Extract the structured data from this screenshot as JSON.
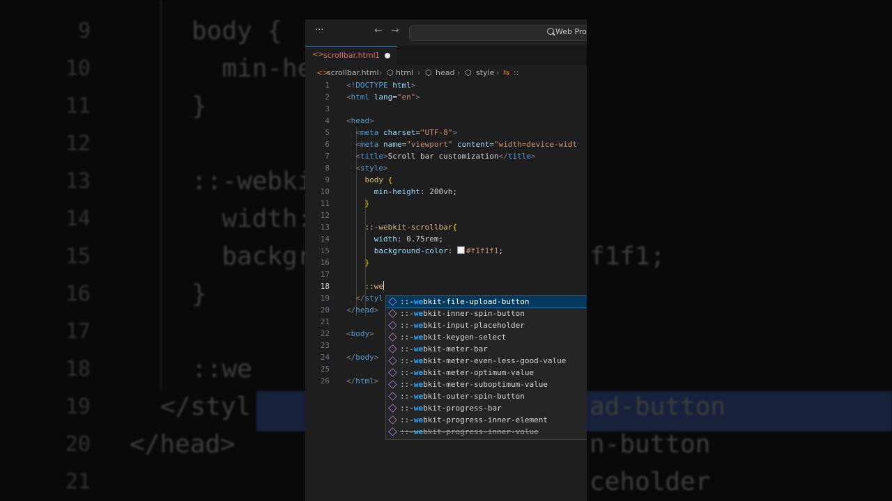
{
  "titlebar": {
    "more": "···",
    "back": "←",
    "forward": "→",
    "search_text": "Web Pro"
  },
  "tab": {
    "icon": "<>",
    "name": "scrollbar.html",
    "problems": "1"
  },
  "breadcrumb": {
    "file": "scrollbar.html",
    "items": [
      "html",
      "head",
      "style",
      "::"
    ]
  },
  "code_lines": [
    {
      "n": "1",
      "text": "<!DOCTYPE html>"
    },
    {
      "n": "2",
      "text": "<html lang=\"en\">"
    },
    {
      "n": "3",
      "text": ""
    },
    {
      "n": "4",
      "text": "<head>"
    },
    {
      "n": "5",
      "text": "<meta charset=\"UTF-8\">"
    },
    {
      "n": "6",
      "text": "<meta name=\"viewport\" content=\"width=device-widt"
    },
    {
      "n": "7",
      "text": "<title>Scroll bar customization</title>"
    },
    {
      "n": "8",
      "text": "<style>"
    },
    {
      "n": "9",
      "text": "body {"
    },
    {
      "n": "10",
      "text": "min-height: 200vh;"
    },
    {
      "n": "11",
      "text": "}"
    },
    {
      "n": "12",
      "text": ""
    },
    {
      "n": "13",
      "text": "::-webkit-scrollbar{"
    },
    {
      "n": "14",
      "text": "width: 0.75rem;"
    },
    {
      "n": "15",
      "text": "background-color: #f1f1f1;"
    },
    {
      "n": "16",
      "text": "}"
    },
    {
      "n": "17",
      "text": ""
    },
    {
      "n": "18",
      "text": "::we"
    },
    {
      "n": "19",
      "text": "</styl"
    },
    {
      "n": "20",
      "text": "</head>"
    },
    {
      "n": "21",
      "text": ""
    },
    {
      "n": "22",
      "text": "<body>"
    },
    {
      "n": "23",
      "text": ""
    },
    {
      "n": "24",
      "text": "</body>"
    },
    {
      "n": "25",
      "text": ""
    },
    {
      "n": "26",
      "text": "</html>"
    }
  ],
  "suggestions": {
    "prefix": "::-",
    "match": "we",
    "items": [
      "bkit-file-upload-button",
      "bkit-inner-spin-button",
      "bkit-input-placeholder",
      "bkit-keygen-select",
      "bkit-meter-bar",
      "bkit-meter-even-less-good-value",
      "bkit-meter-optimum-value",
      "bkit-meter-suboptimum-value",
      "bkit-outer-spin-button",
      "bkit-progress-bar",
      "bkit-progress-inner-element",
      "bkit-progress-inner-value"
    ]
  },
  "background": {
    "line_numbers": [
      "9",
      "10",
      "11",
      "12",
      "13",
      "14",
      "15",
      "16",
      "17",
      "18",
      "19",
      "20",
      "21"
    ],
    "code": [
      "body {",
      "  min-he",
      "}",
      "",
      "::-webki",
      "  width:",
      "  backgr",
      "}",
      "",
      "::we",
      "</styl",
      "</head>",
      ""
    ],
    "right": [
      "",
      "",
      "",
      "",
      "",
      "",
      "f1f1;",
      "",
      "",
      "",
      "ad-button",
      "n-button",
      "ceholder"
    ]
  },
  "colors": {
    "accent": "#007fd4",
    "tab_modified": "#e26d6d",
    "html_tag": "#569cd6",
    "attr": "#9cdcfe",
    "string": "#ce9178",
    "selector": "#d7ba7d"
  }
}
